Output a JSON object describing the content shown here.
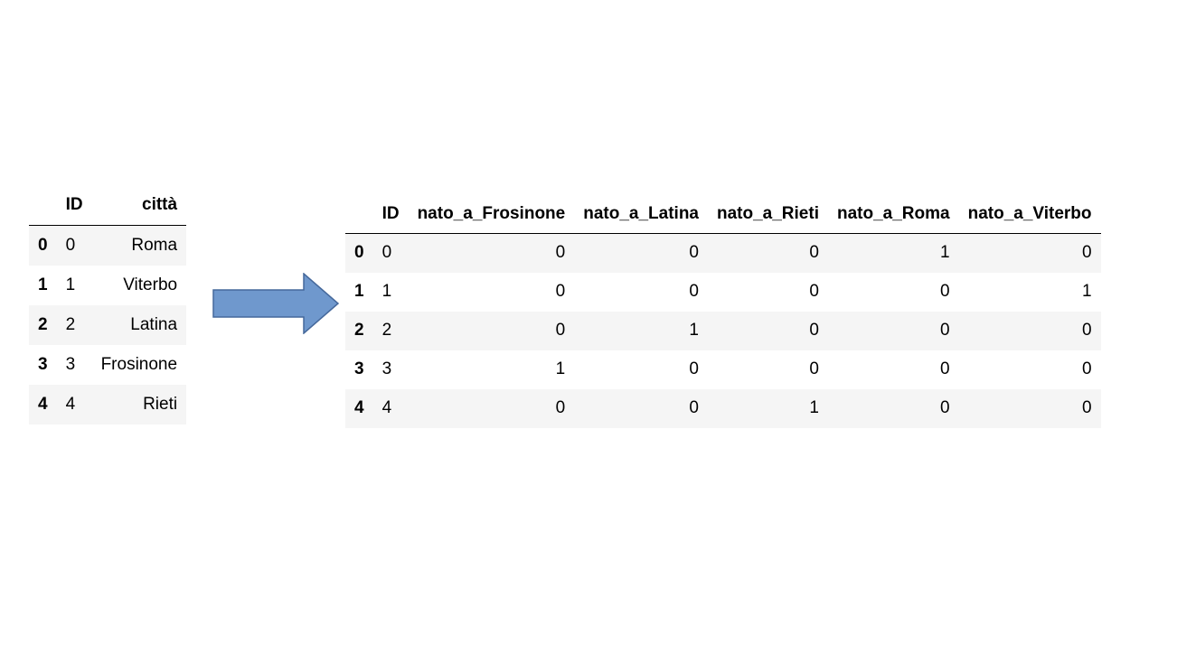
{
  "left_table": {
    "columns": [
      "",
      "ID",
      "città"
    ],
    "rows": [
      {
        "index": "0",
        "ID": "0",
        "citta": "Roma"
      },
      {
        "index": "1",
        "ID": "1",
        "citta": "Viterbo"
      },
      {
        "index": "2",
        "ID": "2",
        "citta": "Latina"
      },
      {
        "index": "3",
        "ID": "3",
        "citta": "Frosinone"
      },
      {
        "index": "4",
        "ID": "4",
        "citta": "Rieti"
      }
    ]
  },
  "arrow": {
    "fill": "#6f98cd",
    "stroke": "#45689b"
  },
  "right_table": {
    "columns": [
      "",
      "ID",
      "nato_a_Frosinone",
      "nato_a_Latina",
      "nato_a_Rieti",
      "nato_a_Roma",
      "nato_a_Viterbo"
    ],
    "rows": [
      {
        "index": "0",
        "ID": "0",
        "values": [
          "0",
          "0",
          "0",
          "1",
          "0"
        ]
      },
      {
        "index": "1",
        "ID": "1",
        "values": [
          "0",
          "0",
          "0",
          "0",
          "1"
        ]
      },
      {
        "index": "2",
        "ID": "2",
        "values": [
          "0",
          "1",
          "0",
          "0",
          "0"
        ]
      },
      {
        "index": "3",
        "ID": "3",
        "values": [
          "1",
          "0",
          "0",
          "0",
          "0"
        ]
      },
      {
        "index": "4",
        "ID": "4",
        "values": [
          "0",
          "0",
          "1",
          "0",
          "0"
        ]
      }
    ]
  }
}
